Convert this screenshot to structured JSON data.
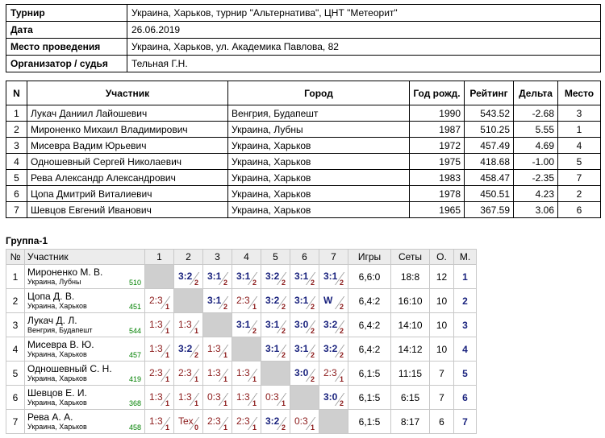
{
  "info": [
    {
      "label": "Турнир",
      "value": "Украина, Харьков, турнир \"Альтернатива\", ЦНТ \"Метеорит\""
    },
    {
      "label": "Дата",
      "value": "26.06.2019"
    },
    {
      "label": "Место проведения",
      "value": "Украина, Харьков, ул. Академика Павлова, 82"
    },
    {
      "label": "Организатор / судья",
      "value": "Тельная Г.Н."
    }
  ],
  "participants": {
    "headers": [
      "N",
      "Участник",
      "Город",
      "Год рожд.",
      "Рейтинг",
      "Дельта",
      "Место"
    ],
    "rows": [
      [
        "1",
        "Лукач Даниил Лайошевич",
        "Венгрия, Будапешт",
        "1990",
        "543.52",
        "-2.68",
        "3"
      ],
      [
        "2",
        "Мироненко Михаил Владимирович",
        "Украина, Лубны",
        "1987",
        "510.25",
        "5.55",
        "1"
      ],
      [
        "3",
        "Мисевра Вадим Юрьевич",
        "Украина, Харьков",
        "1972",
        "457.49",
        "4.69",
        "4"
      ],
      [
        "4",
        "Одношевный Сергей Николаевич",
        "Украина, Харьков",
        "1975",
        "418.68",
        "-1.00",
        "5"
      ],
      [
        "5",
        "Рева Александр Александрович",
        "Украина, Харьков",
        "1983",
        "458.47",
        "-2.35",
        "7"
      ],
      [
        "6",
        "Цопа Дмитрий Виталиевич",
        "Украина, Харьков",
        "1978",
        "450.51",
        "4.23",
        "2"
      ],
      [
        "7",
        "Шевцов Евгений Иванович",
        "Украина, Харьков",
        "1965",
        "367.59",
        "3.06",
        "6"
      ]
    ]
  },
  "group": {
    "title": "Группа-1",
    "headers": [
      "№",
      "Участник",
      "1",
      "2",
      "3",
      "4",
      "5",
      "6",
      "7",
      "Игры",
      "Сеты",
      "О.",
      "М."
    ],
    "rows": [
      {
        "n": "1",
        "name": "Мироненко М. В.",
        "city": "Украина, Лубны",
        "rating": "510",
        "cells": [
          null,
          [
            "3:2",
            "2",
            "w"
          ],
          [
            "3:1",
            "2",
            "w"
          ],
          [
            "3:1",
            "2",
            "w"
          ],
          [
            "3:2",
            "2",
            "w"
          ],
          [
            "3:1",
            "2",
            "w"
          ],
          [
            "3:1",
            "2",
            "w"
          ]
        ],
        "games": "6,6:0",
        "sets": "18:8",
        "points": "12",
        "place": "1"
      },
      {
        "n": "2",
        "name": "Цопа Д. В.",
        "city": "Украина, Харьков",
        "rating": "451",
        "cells": [
          [
            "2:3",
            "1",
            "l"
          ],
          null,
          [
            "3:1",
            "2",
            "w"
          ],
          [
            "2:3",
            "1",
            "l"
          ],
          [
            "3:2",
            "2",
            "w"
          ],
          [
            "3:1",
            "2",
            "w"
          ],
          [
            "W",
            "2",
            "w"
          ]
        ],
        "games": "6,4:2",
        "sets": "16:10",
        "points": "10",
        "place": "2"
      },
      {
        "n": "3",
        "name": "Лукач Д. Л.",
        "city": "Венгрия, Будапешт",
        "rating": "544",
        "cells": [
          [
            "1:3",
            "1",
            "l"
          ],
          [
            "1:3",
            "1",
            "l"
          ],
          null,
          [
            "3:1",
            "2",
            "w"
          ],
          [
            "3:1",
            "2",
            "w"
          ],
          [
            "3:0",
            "2",
            "w"
          ],
          [
            "3:2",
            "2",
            "w"
          ]
        ],
        "games": "6,4:2",
        "sets": "14:10",
        "points": "10",
        "place": "3"
      },
      {
        "n": "4",
        "name": "Мисевра В. Ю.",
        "city": "Украина, Харьков",
        "rating": "457",
        "cells": [
          [
            "1:3",
            "1",
            "l"
          ],
          [
            "3:2",
            "2",
            "w"
          ],
          [
            "1:3",
            "1",
            "l"
          ],
          null,
          [
            "3:1",
            "2",
            "w"
          ],
          [
            "3:1",
            "2",
            "w"
          ],
          [
            "3:2",
            "2",
            "w"
          ]
        ],
        "games": "6,4:2",
        "sets": "14:12",
        "points": "10",
        "place": "4"
      },
      {
        "n": "5",
        "name": "Одношевный С. Н.",
        "city": "Украина, Харьков",
        "rating": "419",
        "cells": [
          [
            "2:3",
            "1",
            "l"
          ],
          [
            "2:3",
            "1",
            "l"
          ],
          [
            "1:3",
            "1",
            "l"
          ],
          [
            "1:3",
            "1",
            "l"
          ],
          null,
          [
            "3:0",
            "2",
            "w"
          ],
          [
            "2:3",
            "1",
            "l"
          ]
        ],
        "games": "6,1:5",
        "sets": "11:15",
        "points": "7",
        "place": "5"
      },
      {
        "n": "6",
        "name": "Шевцов Е. И.",
        "city": "Украина, Харьков",
        "rating": "368",
        "cells": [
          [
            "1:3",
            "1",
            "l"
          ],
          [
            "1:3",
            "1",
            "l"
          ],
          [
            "0:3",
            "1",
            "l"
          ],
          [
            "1:3",
            "1",
            "l"
          ],
          [
            "0:3",
            "1",
            "l"
          ],
          null,
          [
            "3:0",
            "2",
            "w"
          ]
        ],
        "games": "6,1:5",
        "sets": "6:15",
        "points": "7",
        "place": "6"
      },
      {
        "n": "7",
        "name": "Рева А. А.",
        "city": "Украина, Харьков",
        "rating": "458",
        "cells": [
          [
            "1:3",
            "1",
            "l"
          ],
          [
            "Tex",
            "0",
            "l"
          ],
          [
            "2:3",
            "1",
            "l"
          ],
          [
            "2:3",
            "1",
            "l"
          ],
          [
            "3:2",
            "2",
            "w"
          ],
          [
            "0:3",
            "1",
            "l"
          ],
          null
        ],
        "games": "6,1:5",
        "sets": "8:17",
        "points": "6",
        "place": "7"
      }
    ]
  }
}
